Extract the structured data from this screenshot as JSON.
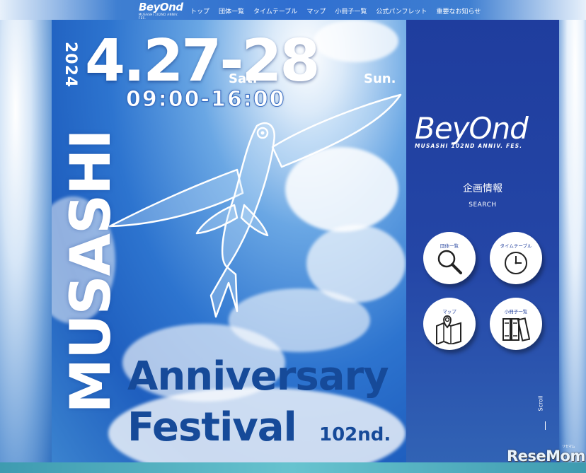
{
  "nav": {
    "logo_word": "BeyOnd",
    "logo_sub": "MUSASHI 102ND ANNIV. FES.",
    "items": [
      "トップ",
      "団体一覧",
      "タイムテーブル",
      "マップ",
      "小冊子一覧",
      "公式パンフレット",
      "重要なお知らせ"
    ]
  },
  "poster": {
    "year": "2024",
    "vertical_title": "MUSASHI",
    "date": "4.27-28",
    "day1": "Sat.",
    "day2": "Sun.",
    "time": "09:00-16:00",
    "line1": "Anniversary",
    "line2": "Festival",
    "edition": "102nd."
  },
  "panel": {
    "brand_word": "BeyOnd",
    "brand_sub": "MUSASHI 102ND ANNIV. FES.",
    "section_title": "企画情報",
    "section_sub": "SEARCH",
    "buttons": [
      {
        "label": "団体一覧",
        "icon": "magnifier-icon"
      },
      {
        "label": "タイムテーブル",
        "icon": "clock-icon"
      },
      {
        "label": "マップ",
        "icon": "map-icon"
      },
      {
        "label": "小冊子一覧",
        "icon": "books-icon"
      }
    ],
    "scroll": "Scroll"
  },
  "watermark": {
    "text": "ReseMom",
    "kana": "リセマム"
  },
  "colors": {
    "panel": "#2446a6",
    "poster_text": "#164a99",
    "accent": "#2f6ed0"
  }
}
